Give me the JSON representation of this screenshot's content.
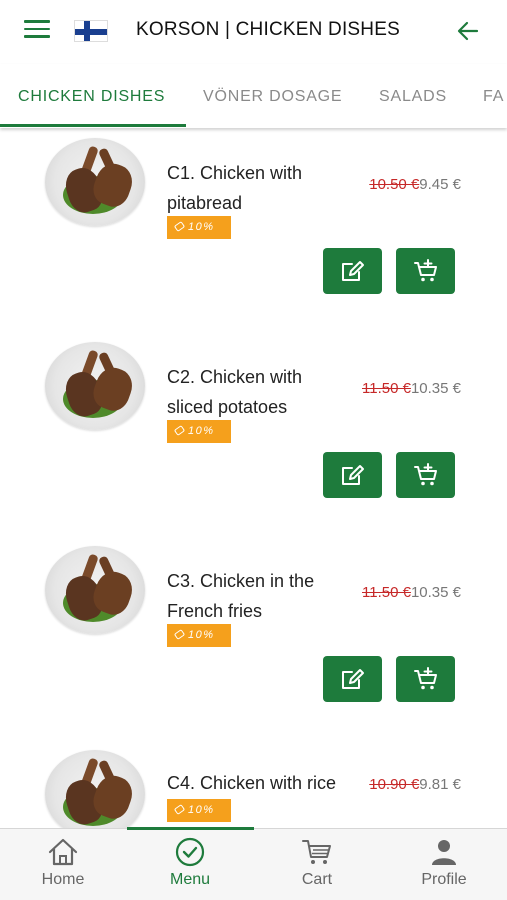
{
  "header": {
    "title": "KORSON | CHICKEN DISHES",
    "menu_icon": "hamburger-icon",
    "flag_icon": "finland-flag-icon",
    "back_icon": "arrow-left-icon",
    "accent_color": "#1e7b3c"
  },
  "tabs": [
    {
      "label": "CHICKEN DISHES",
      "active": true
    },
    {
      "label": "VÖNER DOSAGE",
      "active": false
    },
    {
      "label": "SALADS",
      "active": false
    },
    {
      "label": "FA",
      "active": false
    }
  ],
  "items": [
    {
      "name": "C1. Chicken with pitabread",
      "old_price": "10.50 €",
      "price": "9.45 €",
      "discount": "10%"
    },
    {
      "name": "C2. Chicken with sliced potatoes",
      "old_price": "11.50 €",
      "price": "10.35 €",
      "discount": "10%"
    },
    {
      "name": "C3. Chicken in the French fries",
      "old_price": "11.50 €",
      "price": "10.35 €",
      "discount": "10%"
    },
    {
      "name": "C4. Chicken with rice",
      "old_price": "10.90 €",
      "price": "9.81 €",
      "discount": "10%"
    }
  ],
  "item_actions": {
    "edit_icon": "edit-icon",
    "add_to_cart_icon": "cart-add-icon"
  },
  "bottom_nav": [
    {
      "label": "Home",
      "icon": "home-icon",
      "active": false
    },
    {
      "label": "Menu",
      "icon": "check-circle-icon",
      "active": true
    },
    {
      "label": "Cart",
      "icon": "cart-icon",
      "active": false
    },
    {
      "label": "Profile",
      "icon": "person-icon",
      "active": false
    }
  ],
  "colors": {
    "discount_badge": "#f5a01c",
    "old_price": "#c62828",
    "button": "#1e7b3c"
  }
}
